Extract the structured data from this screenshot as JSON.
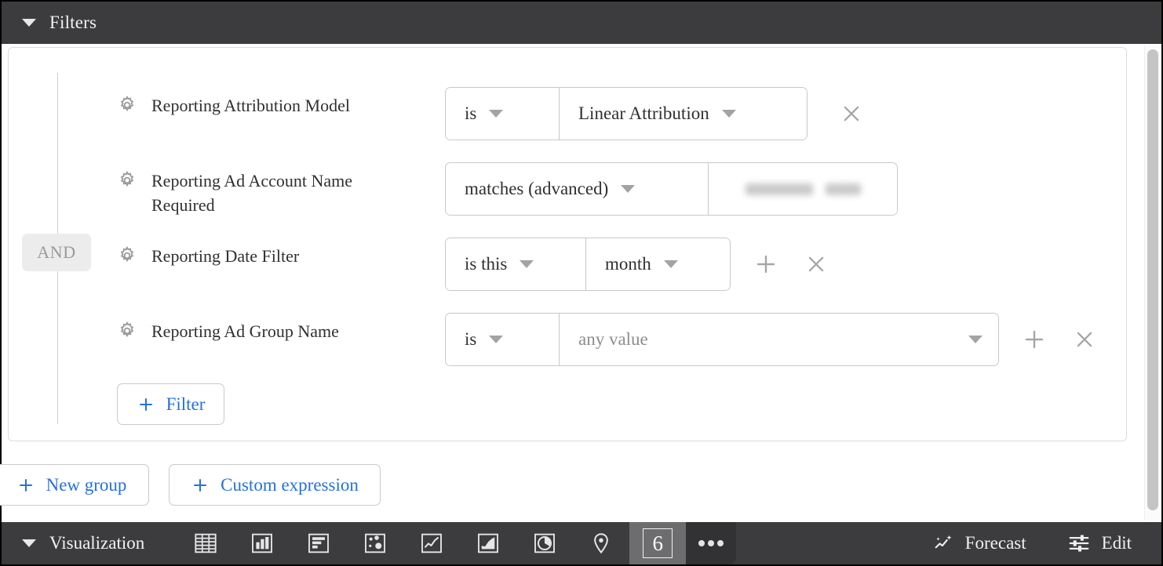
{
  "header": {
    "title": "Filters",
    "collapse_icon": "caret-down-icon"
  },
  "filters_panel": {
    "group_operator": "AND",
    "rows": [
      {
        "field_icon": "gear-icon",
        "field": "Reporting Attribution Model",
        "operator": "is",
        "value": "Linear Attribution",
        "value_kind": "dropdown",
        "has_add": false,
        "has_remove": true
      },
      {
        "field_icon": "gear-icon",
        "field": "Reporting Ad Account Name Required",
        "operator": "matches (advanced)",
        "value": "",
        "value_kind": "redacted-text",
        "has_add": false,
        "has_remove": false
      },
      {
        "field_icon": "gear-icon",
        "field": "Reporting Date Filter",
        "operator": "is this",
        "value": "month",
        "value_kind": "dropdown",
        "has_add": true,
        "has_remove": true
      },
      {
        "field_icon": "gear-icon",
        "field": "Reporting Ad Group Name",
        "operator": "is",
        "value": "any value",
        "value_kind": "dropdown-placeholder",
        "has_add": true,
        "has_remove": true
      }
    ],
    "add_filter_label": "Filter",
    "add_filter_icon": "plus-icon",
    "add_icon": "plus-icon",
    "remove_icon": "close-icon"
  },
  "bottom_actions": {
    "new_group_label": "New group",
    "new_group_icon": "plus-icon",
    "custom_expression_label": "Custom expression",
    "custom_expression_icon": "plus-icon"
  },
  "visualization_bar": {
    "label": "Visualization",
    "collapse_icon": "caret-down-icon",
    "chart_types": [
      {
        "name": "table-icon",
        "title": "Table",
        "selected": false
      },
      {
        "name": "column-chart-icon",
        "title": "Column",
        "selected": false
      },
      {
        "name": "bar-chart-icon",
        "title": "Bar",
        "selected": false
      },
      {
        "name": "scatter-plot-icon",
        "title": "Scatterplot",
        "selected": false
      },
      {
        "name": "line-chart-icon",
        "title": "Line",
        "selected": false
      },
      {
        "name": "area-chart-icon",
        "title": "Area",
        "selected": false
      },
      {
        "name": "pie-chart-icon",
        "title": "Pie",
        "selected": false
      },
      {
        "name": "map-pin-icon",
        "title": "Map",
        "selected": false
      },
      {
        "name": "single-value-icon",
        "title": "Single value",
        "selected": true,
        "glyph": "6"
      },
      {
        "name": "more-options-icon",
        "title": "More",
        "selected": false
      }
    ],
    "forecast_label": "Forecast",
    "forecast_icon": "forecast-sparkle-icon",
    "edit_label": "Edit",
    "edit_icon": "sliders-icon"
  },
  "colors": {
    "dark_bar": "#3c3c3e",
    "accent_blue": "#2471e0",
    "border_gray": "#c8c8c8",
    "text_dark": "#2f3031",
    "placeholder_gray": "#8d8d8d",
    "selected_tile": "#6d6d6f"
  },
  "scrollbar": {
    "orientation": "vertical"
  }
}
